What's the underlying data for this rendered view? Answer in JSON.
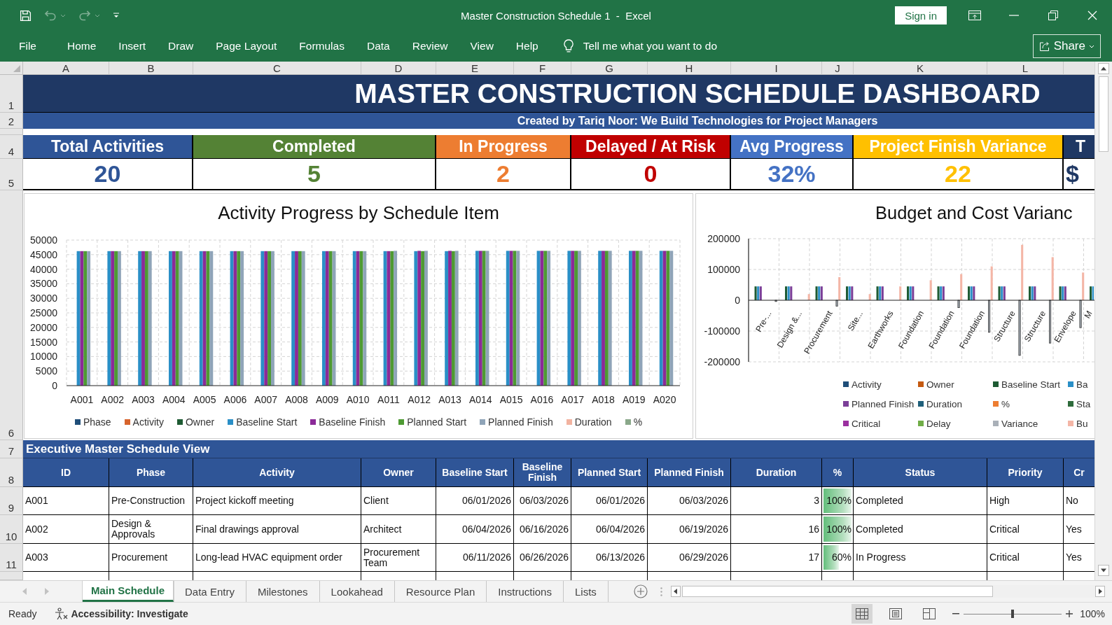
{
  "window": {
    "title": "Master Construction Schedule 1  -  Excel",
    "sign_in": "Sign in"
  },
  "quick_access": [
    {
      "kind": "save",
      "disabled": false
    },
    {
      "kind": "undo",
      "disabled": true
    },
    {
      "kind": "redo",
      "disabled": true
    },
    {
      "kind": "customize",
      "disabled": false
    }
  ],
  "menu": {
    "items": [
      "File",
      "Home",
      "Insert",
      "Draw",
      "Page Layout",
      "Formulas",
      "Data",
      "Review",
      "View",
      "Help"
    ],
    "tell_me": "Tell me what you want to do",
    "share": "Share"
  },
  "sheet": {
    "columns": [
      "A",
      "B",
      "C",
      "D",
      "E",
      "F",
      "G",
      "H",
      "I",
      "J",
      "K",
      "L"
    ],
    "row_numbers": [
      "1",
      "2",
      "4",
      "5",
      "6",
      "7",
      "8",
      "9",
      "10",
      "11"
    ]
  },
  "dashboard": {
    "title": "MASTER CONSTRUCTION SCHEDULE DASHBOARD",
    "subtitle": "Created by Tariq Noor: We Build Technologies for Project Managers",
    "kpis": [
      {
        "label": "Total Activities",
        "value": "20",
        "color": "#2f5597"
      },
      {
        "label": "Completed",
        "value": "5",
        "color": "#548235"
      },
      {
        "label": "In Progress",
        "value": "2",
        "color": "#ed7d31"
      },
      {
        "label": "Delayed / At Risk",
        "value": "0",
        "color": "#c00000"
      },
      {
        "label": "Avg Progress",
        "value": "32%",
        "color": "#4472c4"
      },
      {
        "label": "Project Finish Variance",
        "value": "22",
        "color": "#ffc000"
      },
      {
        "label": "T",
        "value": "$",
        "color": "#1f3864"
      }
    ]
  },
  "charts": [
    {
      "chart_data": {
        "type": "bar",
        "title": "Activity Progress by Schedule Item",
        "categories": [
          "A001",
          "A002",
          "A003",
          "A004",
          "A005",
          "A006",
          "A007",
          "A008",
          "A009",
          "A010",
          "A011",
          "A012",
          "A013",
          "A014",
          "A015",
          "A016",
          "A017",
          "A018",
          "A019",
          "A020"
        ],
        "series": [
          {
            "name": "Phase",
            "color": "#1f4e79",
            "values": [
              0,
              0,
              0,
              0,
              0,
              0,
              0,
              0,
              0,
              0,
              0,
              0,
              0,
              0,
              0,
              0,
              0,
              0,
              0,
              0
            ]
          },
          {
            "name": "Activity",
            "color": "#d7642d",
            "values": [
              0,
              0,
              0,
              0,
              0,
              0,
              0,
              0,
              0,
              0,
              0,
              0,
              0,
              0,
              0,
              0,
              0,
              0,
              0,
              0
            ]
          },
          {
            "name": "Owner",
            "color": "#1e5b33",
            "values": [
              0,
              0,
              0,
              0,
              0,
              0,
              0,
              0,
              0,
              0,
              0,
              0,
              0,
              0,
              0,
              0,
              0,
              0,
              0,
              0
            ]
          },
          {
            "name": "Baseline Start",
            "color": "#2a8fc7",
            "values": [
              46200,
              46200,
              46200,
              46200,
              46200,
              46200,
              46200,
              46200,
              46200,
              46200,
              46200,
              46200,
              46200,
              46300,
              46300,
              46300,
              46300,
              46300,
              46300,
              46300
            ]
          },
          {
            "name": "Baseline Finish",
            "color": "#8b2a98",
            "values": [
              46200,
              46200,
              46200,
              46200,
              46200,
              46200,
              46200,
              46200,
              46200,
              46200,
              46200,
              46300,
              46300,
              46300,
              46300,
              46300,
              46300,
              46300,
              46300,
              46300
            ]
          },
          {
            "name": "Planned Start",
            "color": "#4e9a33",
            "values": [
              46200,
              46200,
              46200,
              46200,
              46200,
              46200,
              46200,
              46200,
              46200,
              46200,
              46200,
              46200,
              46200,
              46300,
              46300,
              46300,
              46300,
              46300,
              46300,
              46300
            ]
          },
          {
            "name": "Planned Finish",
            "color": "#8fa4b8",
            "values": [
              46200,
              46200,
              46200,
              46200,
              46200,
              46200,
              46200,
              46200,
              46200,
              46200,
              46300,
              46300,
              46300,
              46300,
              46300,
              46300,
              46300,
              46300,
              46300,
              46300
            ]
          },
          {
            "name": "Duration",
            "color": "#f2b3a0",
            "values": [
              0,
              0,
              0,
              0,
              0,
              0,
              0,
              0,
              0,
              0,
              0,
              0,
              0,
              0,
              0,
              0,
              0,
              0,
              0,
              0
            ]
          },
          {
            "name": "%",
            "color": "#8aa88a",
            "values": [
              0,
              0,
              0,
              0,
              0,
              0,
              0,
              0,
              0,
              0,
              0,
              0,
              0,
              0,
              0,
              0,
              0,
              0,
              0,
              0
            ]
          }
        ],
        "ylim": [
          0,
          50000
        ],
        "yticks": [
          0,
          5000,
          10000,
          15000,
          20000,
          25000,
          30000,
          35000,
          40000,
          45000,
          50000
        ],
        "stacked": false,
        "grid": true,
        "legend": "bottom"
      }
    },
    {
      "chart_data": {
        "type": "bar",
        "title": "Budget and Cost Varianc",
        "categories": [
          "Pre-...",
          "Design &...",
          "Procurement",
          "Site...",
          "Earthworks",
          "Foundation",
          "Foundation",
          "Foundation",
          "Structure",
          "Structure",
          "Envelope",
          "M"
        ],
        "series": [
          {
            "name": "Activity",
            "color": "#1f4e79",
            "values": [
              0,
              0,
              0,
              0,
              0,
              0,
              0,
              0,
              0,
              0,
              0,
              0
            ]
          },
          {
            "name": "Owner",
            "color": "#c55a11",
            "values": [
              0,
              0,
              0,
              0,
              0,
              0,
              0,
              0,
              0,
              0,
              0,
              0
            ]
          },
          {
            "name": "Baseline Start",
            "color": "#1e5b33",
            "values": [
              45000,
              45000,
              45000,
              45000,
              45000,
              45000,
              45000,
              45000,
              45000,
              45000,
              45000,
              45000
            ]
          },
          {
            "name": "Ba",
            "color": "#2a8fc7",
            "values": [
              45000,
              45000,
              45000,
              45000,
              45000,
              45000,
              45000,
              45000,
              45000,
              45000,
              45000,
              45000
            ]
          },
          {
            "name": "Planned Finish",
            "color": "#7b3f98",
            "values": [
              45000,
              45000,
              45000,
              45000,
              45000,
              45000,
              45000,
              45000,
              45000,
              45000,
              45000,
              null
            ]
          },
          {
            "name": "Duration",
            "color": "#1f5f7a",
            "values": [
              0,
              0,
              0,
              0,
              0,
              0,
              0,
              0,
              0,
              0,
              0,
              null
            ]
          },
          {
            "name": "%",
            "color": "#ed7d31",
            "values": [
              0,
              0,
              0,
              0,
              0,
              0,
              0,
              0,
              0,
              0,
              0,
              null
            ]
          },
          {
            "name": "Sta",
            "color": "#2e6b3b",
            "values": [
              0,
              0,
              0,
              0,
              0,
              0,
              0,
              0,
              0,
              0,
              0,
              null
            ]
          },
          {
            "name": "Critical",
            "color": "#9b30a0",
            "values": [
              0,
              0,
              0,
              0,
              0,
              0,
              0,
              0,
              0,
              0,
              0,
              null
            ]
          },
          {
            "name": "Delay",
            "color": "#70ad47",
            "values": [
              0,
              0,
              0,
              0,
              0,
              0,
              0,
              0,
              0,
              0,
              0,
              null
            ]
          },
          {
            "name": "Variance",
            "color": "#a9b0b8",
            "values": [
              -5000,
              0,
              -20000,
              0,
              0,
              0,
              -25000,
              -105000,
              -180000,
              -140000,
              -90000,
              null
            ]
          },
          {
            "name": "Bu",
            "color": "#f4b6a6",
            "values": [
              0,
              20000,
              75000,
              20000,
              45000,
              65000,
              85000,
              110000,
              180000,
              140000,
              90000,
              null
            ]
          }
        ],
        "ylim": [
          -200000,
          200000
        ],
        "yticks": [
          -200000,
          -100000,
          0,
          100000,
          200000
        ],
        "stacked": false,
        "grid": true,
        "legend": "bottom"
      }
    }
  ],
  "schedule": {
    "title": "Executive Master Schedule View",
    "columns": [
      {
        "label": "ID",
        "kind": "text"
      },
      {
        "label": "Phase",
        "kind": "text"
      },
      {
        "label": "Activity",
        "kind": "text"
      },
      {
        "label": "Owner",
        "kind": "text"
      },
      {
        "label": "Baseline Start",
        "kind": "date"
      },
      {
        "label": "Baseline Finish",
        "kind": "date"
      },
      {
        "label": "Planned Start",
        "kind": "date"
      },
      {
        "label": "Planned Finish",
        "kind": "date"
      },
      {
        "label": "Duration",
        "kind": "number"
      },
      {
        "label": "%",
        "kind": "percent"
      },
      {
        "label": "Status",
        "kind": "text"
      },
      {
        "label": "Priority",
        "kind": "text"
      },
      {
        "label": "Cr",
        "kind": "text"
      }
    ],
    "rows": [
      {
        "cells": [
          "A001",
          "Pre-Construction",
          "Project kickoff meeting",
          "Client",
          "06/01/2026",
          "06/03/2026",
          "06/01/2026",
          "06/03/2026",
          "3",
          "100%",
          "Completed",
          "High",
          "No"
        ],
        "level": 1
      },
      {
        "cells": [
          "A002",
          "Design & Approvals",
          "Final drawings approval",
          "Architect",
          "06/04/2026",
          "06/16/2026",
          "06/04/2026",
          "06/19/2026",
          "16",
          "100%",
          "Completed",
          "Critical",
          "Yes"
        ],
        "level": 1
      },
      {
        "cells": [
          "A003",
          "Procurement",
          "Long-lead HVAC equipment order",
          "Procurement Team",
          "06/11/2026",
          "06/26/2026",
          "06/13/2026",
          "06/29/2026",
          "17",
          "60%",
          "In Progress",
          "Critical",
          "Yes"
        ],
        "level": 0.6
      }
    ]
  },
  "sheet_tabs": [
    {
      "label": "Main Schedule",
      "selected": true
    },
    {
      "label": "Data Entry",
      "selected": false
    },
    {
      "label": "Milestones",
      "selected": false
    },
    {
      "label": "Lookahead",
      "selected": false
    },
    {
      "label": "Resource Plan",
      "selected": false
    },
    {
      "label": "Instructions",
      "selected": false
    },
    {
      "label": "Lists",
      "selected": false
    }
  ],
  "status_bar": {
    "status": "Ready",
    "accessibility": "Accessibility: Investigate",
    "views": [
      {
        "kind": "normal",
        "selected": true
      },
      {
        "kind": "page-layout",
        "selected": false
      },
      {
        "kind": "page-break",
        "selected": false
      }
    ],
    "zoom": {
      "level": 0.5,
      "reading": "100%"
    }
  }
}
